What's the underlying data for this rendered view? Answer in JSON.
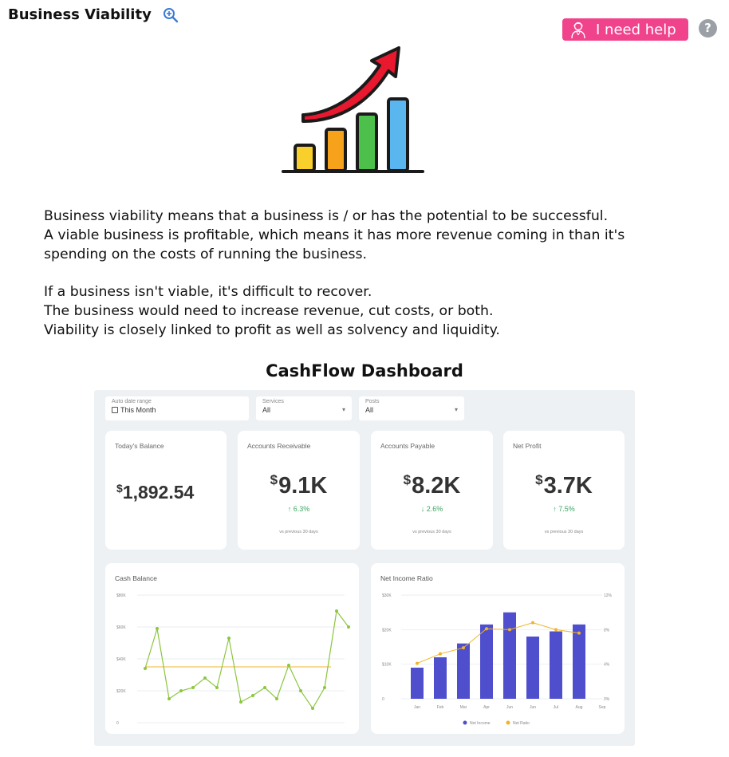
{
  "header": {
    "title": "Business Viability",
    "help_label": "I need help",
    "question_label": "?"
  },
  "icons": {
    "zoom": "magnifier-plus-icon",
    "person": "support-person-icon",
    "growth": "growth-bar-chart-arrow-icon"
  },
  "intro": {
    "line1": "Business viability means that a business is / or has the potential to be successful.",
    "line2": "A viable business is profitable, which means it has more revenue coming in than it's",
    "line3": "spending on the costs of running the business.",
    "line4": "If a business isn't viable, it's difficult to recover.",
    "line5": "The business would need to increase revenue, cut costs, or both.",
    "line6": "Viability is closely linked to profit as well as solvency and liquidity."
  },
  "dashboard": {
    "title": "CashFlow Dashboard",
    "filters": [
      {
        "label": "Auto date range",
        "value": "This Month"
      },
      {
        "label": "Services",
        "value": "All"
      },
      {
        "label": "Posts",
        "value": "All"
      }
    ],
    "kpis": [
      {
        "label": "Today's Balance",
        "currency": "$",
        "value": "1,892.54"
      },
      {
        "label": "Accounts Receivable",
        "currency": "$",
        "value": "9.1K",
        "change": "↑ 6.3%",
        "note": "vs previous 30 days"
      },
      {
        "label": "Accounts Payable",
        "currency": "$",
        "value": "8.2K",
        "change": "↓ 2.6%",
        "note": "vs previous 30 days"
      },
      {
        "label": "Net Profit",
        "currency": "$",
        "value": "3.7K",
        "change": "↑ 7.5%",
        "note": "vs previous 30 days"
      }
    ]
  },
  "colors": {
    "help_button": "#f0438c",
    "line_green": "#8cc63f",
    "avg_line": "#f0b429",
    "bar_blue": "#4f4fce",
    "ratio_orange": "#f0b429",
    "positive": "#3ea864"
  },
  "chart_data": [
    {
      "type": "line",
      "title": "Cash Balance",
      "y_ticks": [
        "$80K",
        "$60K",
        "$40K",
        "$20K",
        "0"
      ],
      "ylim": [
        0,
        80000
      ],
      "series": [
        {
          "values": [
            34000,
            59000,
            15000,
            20000,
            22000,
            28000,
            22000,
            53000,
            13000,
            17000,
            22000,
            15000,
            36000,
            20000,
            9000,
            22000,
            70000,
            60000
          ]
        }
      ],
      "average": 35000,
      "grid": true
    },
    {
      "type": "bar",
      "title": "Net Income Ratio",
      "categories": [
        "Jan",
        "Feb",
        "Mar",
        "Apr",
        "Jun",
        "Jun",
        "Jul",
        "Aug",
        "Sep"
      ],
      "y_ticks_left": [
        "$30K",
        "$20K",
        "$10K",
        "0"
      ],
      "y_ticks_right": [
        "12%",
        "8%",
        "4%",
        "0%"
      ],
      "ylim_left": [
        0,
        30000
      ],
      "ylim_right": [
        0,
        12
      ],
      "series": [
        {
          "name": "Net Income",
          "values": [
            9000,
            12000,
            16000,
            21500,
            25000,
            18000,
            19500,
            21500
          ]
        },
        {
          "name": "Net Ratio",
          "values": [
            4.1,
            5.2,
            5.9,
            8.1,
            8.0,
            8.8,
            8.0,
            7.6
          ]
        }
      ],
      "legend": "bottom-center",
      "grid": true
    }
  ]
}
